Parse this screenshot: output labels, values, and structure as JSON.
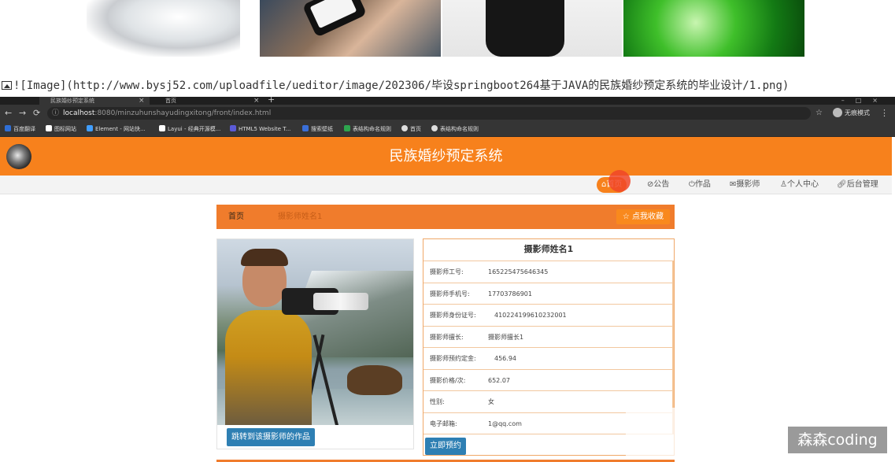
{
  "markdown_line": "![Image](http://www.bysj52.com/uploadfile/ueditor/image/202306/毕设springboot264基于JAVA的民族婚纱预定系统的毕业设计/1.png)",
  "browser": {
    "tabs": [
      {
        "label": "民族婚纱预定系统"
      },
      {
        "label": "首页"
      }
    ],
    "url_host": "localhost",
    "url_rest": ":8080/minzuhunshayudingxitong/front/index.html",
    "profile": "无痕模式",
    "bookmarks": [
      {
        "label": "百度翻译",
        "color": "#2f6fd6"
      },
      {
        "label": "图标网站",
        "color": "#ffffff"
      },
      {
        "label": "Element - 网站快...",
        "color": "#409eff"
      },
      {
        "label": "Layui - 经典开源模...",
        "color": "#ffffff"
      },
      {
        "label": "HTML5 Website T...",
        "color": "#5a5ad6"
      },
      {
        "label": "搜索壁纸",
        "color": "#3a6fd8"
      },
      {
        "label": "表结构命名规则",
        "color": "#2da44e"
      },
      {
        "label": "首页",
        "color": "#dddddd"
      },
      {
        "label": "表结构命名规则",
        "color": "#dddddd"
      }
    ]
  },
  "site": {
    "title": "民族婚纱预定系统",
    "nav": [
      {
        "label": "首页",
        "icon": "home-icon"
      },
      {
        "label": "公告",
        "icon": "tag-icon"
      },
      {
        "label": "作品",
        "icon": "power-icon"
      },
      {
        "label": "摄影师",
        "icon": "mail-icon"
      },
      {
        "label": "个人中心",
        "icon": "user-icon"
      },
      {
        "label": "后台管理",
        "icon": "link-icon"
      }
    ]
  },
  "breadcrumb": {
    "home": "首页",
    "current": "摄影师姓名1",
    "favorite": "☆ 点我收藏"
  },
  "photographer": {
    "name": "摄影师姓名1",
    "fields": [
      {
        "key": "摄影师工号:",
        "value": "165225475646345"
      },
      {
        "key": "摄影师手机号:",
        "value": "17703786901"
      },
      {
        "key": "摄影师身份证号:",
        "value": "410224199610232001"
      },
      {
        "key": "摄影师擅长:",
        "value": "摄影师擅长1"
      },
      {
        "key": "摄影师预约定金:",
        "value": "456.94"
      },
      {
        "key": "摄影价格/次:",
        "value": "652.07"
      },
      {
        "key": "性别:",
        "value": "女"
      },
      {
        "key": "电子邮箱:",
        "value": "1@qq.com"
      }
    ],
    "jump_button": "跳转到该摄影师的作品",
    "book_button": "立即预约"
  },
  "watermark": "森森coding",
  "colors": {
    "brand_orange": "#f7811c",
    "breadcrumb_orange": "#f07c2c",
    "button_blue": "#2e7fb3"
  }
}
